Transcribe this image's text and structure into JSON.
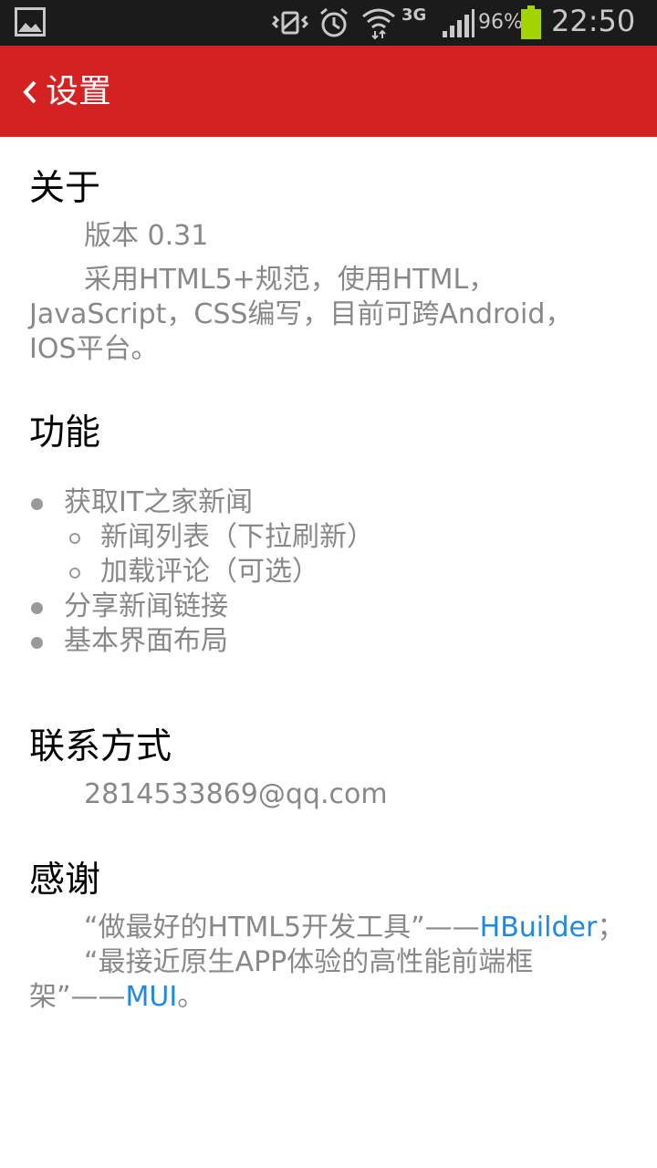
{
  "status_bar": {
    "network": "3G",
    "battery": "96%",
    "time": "22:50"
  },
  "header": {
    "title": "设置"
  },
  "sections": {
    "about": {
      "title": "关于",
      "version": "版本 0.31",
      "desc_line1": "采用HTML5+规范，使用HTML，",
      "desc_line2": "JavaScript，CSS编写，目前可跨Android，",
      "desc_line3": "IOS平台。"
    },
    "features": {
      "title": "功能",
      "items": [
        {
          "label": "获取IT之家新闻",
          "sub": [
            "新闻列表（下拉刷新）",
            "加载评论（可选）"
          ]
        },
        {
          "label": "分享新闻链接"
        },
        {
          "label": "基本界面布局"
        }
      ]
    },
    "contact": {
      "title": "联系方式",
      "email": "2814533869@qq.com"
    },
    "thanks": {
      "title": "感谢",
      "line1_prefix": "“做最好的HTML5开发工具”——",
      "line1_link": "HBuilder",
      "line1_suffix": "；",
      "line2_prefix": "“最接近原生APP体验的高性能前端框",
      "line3_prefix": "架”——",
      "line3_link": "MUI",
      "line3_suffix": "。"
    }
  }
}
